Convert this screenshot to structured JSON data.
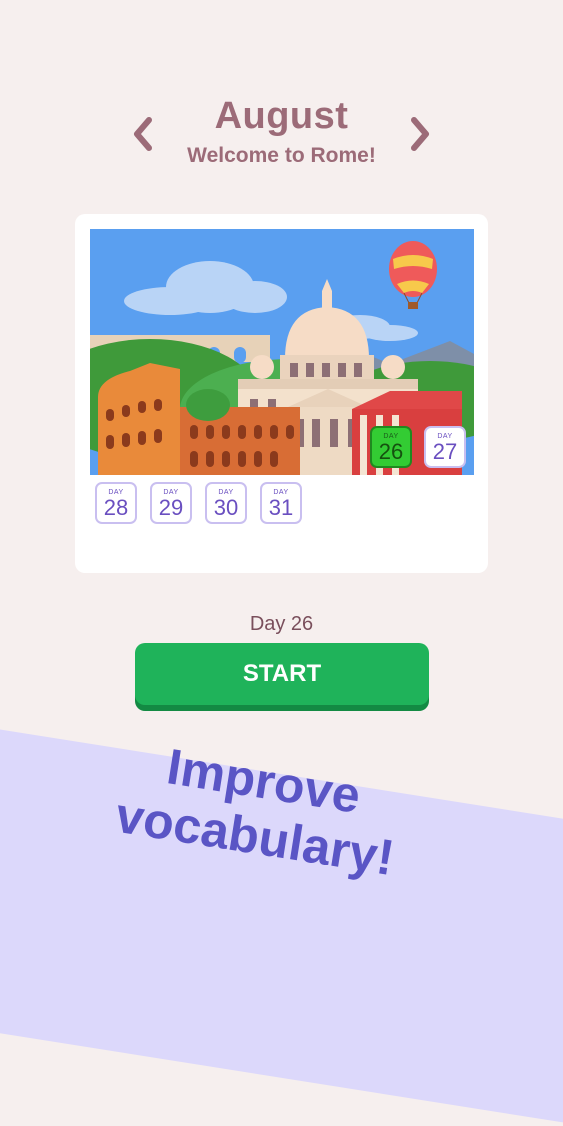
{
  "header": {
    "month": "August",
    "subtitle": "Welcome to Rome!",
    "prev_icon": "chevron-left-icon",
    "next_icon": "chevron-right-icon"
  },
  "calendar": {
    "illustration": "rome-landmarks-illustration",
    "days": [
      {
        "label": "DAY",
        "number": "26",
        "state": "current"
      },
      {
        "label": "DAY",
        "number": "27",
        "state": "upcoming"
      },
      {
        "label": "DAY",
        "number": "28",
        "state": "upcoming"
      },
      {
        "label": "DAY",
        "number": "29",
        "state": "upcoming"
      },
      {
        "label": "DAY",
        "number": "30",
        "state": "upcoming"
      },
      {
        "label": "DAY",
        "number": "31",
        "state": "upcoming"
      }
    ]
  },
  "selected_day": "Day 26",
  "start_label": "START",
  "promo": {
    "line1": "Improve",
    "line2": "vocabulary!"
  },
  "colors": {
    "background": "#f6efee",
    "title": "#9c6b78",
    "start_button": "#1fb35a",
    "current_day": "#33cc33",
    "promo_banner": "#dcd8fb",
    "promo_text": "#5a55c5"
  }
}
